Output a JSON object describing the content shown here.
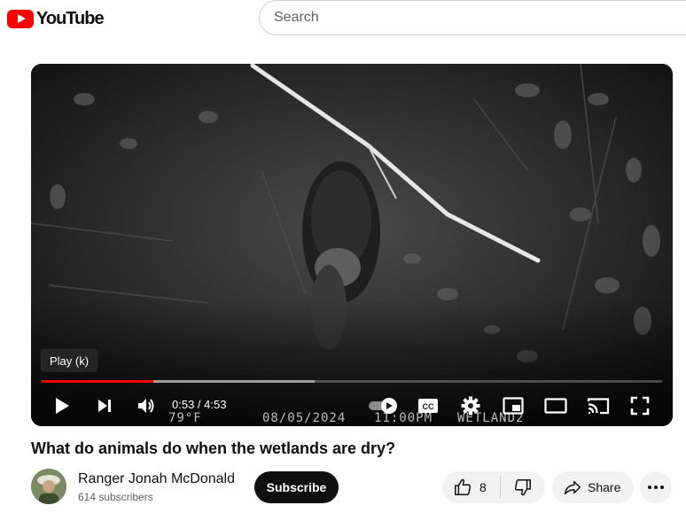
{
  "header": {
    "logo_text": "YouTube",
    "search_placeholder": "Search"
  },
  "player": {
    "tooltip": "Play (k)",
    "current_time": "0:53",
    "separator": " / ",
    "duration": "4:53",
    "progress_fraction": 0.18,
    "buffered_fraction": 0.44,
    "accent_color": "#ff0000",
    "camera_stamp": {
      "temperature": "79°F",
      "date": "08/05/2024",
      "time": "11:00PM",
      "camera": "WETLAND2"
    },
    "controls": [
      "play-icon",
      "next-icon",
      "volume-icon",
      "autoplay-toggle",
      "captions-icon",
      "settings-icon",
      "miniplayer-icon",
      "theater-icon",
      "cast-icon",
      "fullscreen-icon"
    ]
  },
  "video": {
    "title": "What do animals do when the wetlands are dry?"
  },
  "channel": {
    "name": "Ranger Jonah McDonald",
    "subscribers": "614 subscribers",
    "subscribe_label": "Subscribe"
  },
  "actions": {
    "like_count": "8",
    "share_label": "Share"
  }
}
